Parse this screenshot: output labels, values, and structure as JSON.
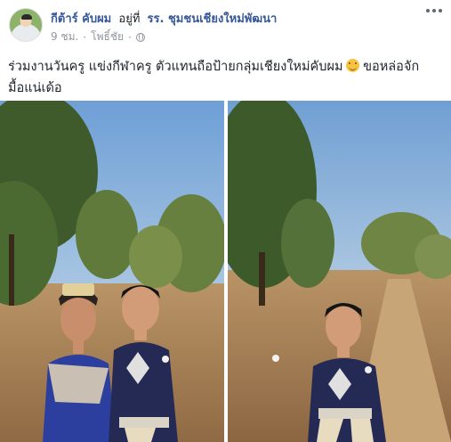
{
  "post": {
    "author": "กีต้าร์ คับผม",
    "at": "อยู่ที่",
    "place": "รร. ชุมชนเชียงใหม่พัฒนา",
    "time": "9 ชม.",
    "separator": "·",
    "location": "โพธิ์ชัย",
    "privacy_icon": "globe-icon",
    "caption_line1": "ร่วมงานวันครู แข่งกีฬาครู ตัวแทนถือป้ายกลุ่มเชียงใหม่คับผม",
    "caption_line2": "ขอหล่อจัก",
    "caption_line3": "มื้อแน่เด้อ",
    "emoji": "smiling-face-emoji",
    "photos": [
      {
        "subject": "couple-in-traditional-dress"
      },
      {
        "subject": "man-in-traditional-dress"
      }
    ]
  },
  "colors": {
    "link": "#365899",
    "meta": "#90949c",
    "text": "#1d2129"
  }
}
